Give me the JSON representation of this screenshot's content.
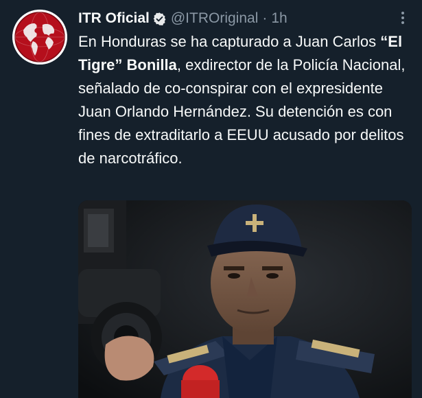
{
  "author": {
    "name": "ITR Oficial",
    "handle": "@ITROriginal",
    "separator": "·",
    "time": "1h"
  },
  "tweet": {
    "segments": [
      {
        "text": "En Honduras se ha capturado a Juan Carlos ",
        "bold": false
      },
      {
        "text": "“El Tigre”",
        "bold": true
      },
      {
        "text": " ",
        "bold": false
      },
      {
        "text": "Bonilla",
        "bold": true
      },
      {
        "text": ", exdirector de la Policía Nacional, señalado de co-conspirar con el expresidente Juan Orlando Hernández. Su detención es con fines de extraditarlo a EEUU acusado por delitos de narcotráfico.",
        "bold": false
      }
    ]
  },
  "icons": {
    "verified": "verified-badge-icon",
    "more": "more-options-icon",
    "avatar": "globe-logo"
  },
  "colors": {
    "background": "#15202b",
    "text": "#f7f9f9",
    "muted": "#8b98a5",
    "avatar_red": "#c1121f"
  }
}
